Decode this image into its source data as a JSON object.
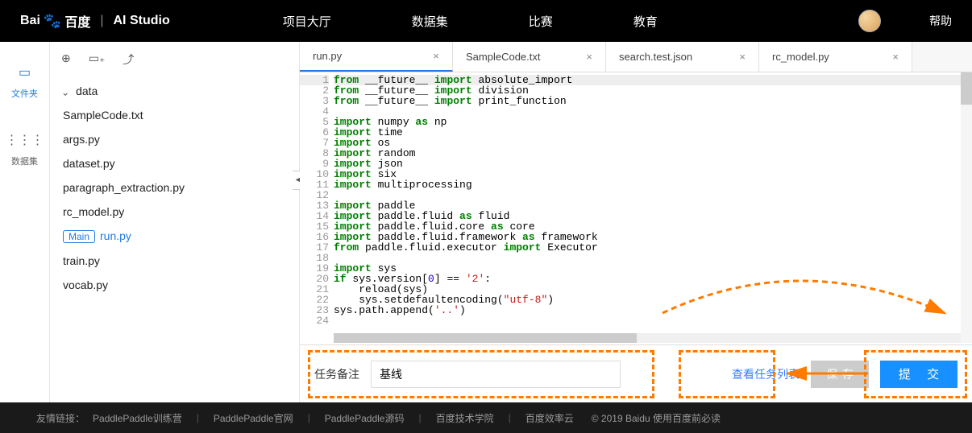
{
  "header": {
    "logo_brand": "Bai",
    "logo_brand2": "百度",
    "logo_app": "AI Studio",
    "nav": [
      "项目大厅",
      "数据集",
      "比赛",
      "教育"
    ],
    "help": "帮助"
  },
  "leftrail": {
    "files_label": "文件夹",
    "dataset_label": "数据集"
  },
  "filetree": {
    "folder": "data",
    "items": [
      "SampleCode.txt",
      "args.py",
      "dataset.py",
      "paragraph_extraction.py",
      "rc_model.py"
    ],
    "main_tag": "Main",
    "main_file": "run.py",
    "items2": [
      "train.py",
      "vocab.py"
    ]
  },
  "tabs": [
    "run.py",
    "SampleCode.txt",
    "search.test.json",
    "rc_model.py"
  ],
  "code": {
    "lines": [
      {
        "n": 1,
        "html": "<span class='kw1'>from</span> __future__ <span class='kw2'>import</span> absolute_import"
      },
      {
        "n": 2,
        "html": "<span class='kw1'>from</span> __future__ <span class='kw2'>import</span> division"
      },
      {
        "n": 3,
        "html": "<span class='kw1'>from</span> __future__ <span class='kw2'>import</span> print_function"
      },
      {
        "n": 4,
        "html": ""
      },
      {
        "n": 5,
        "html": "<span class='kw2'>import</span> numpy <span class='kw1'>as</span> np"
      },
      {
        "n": 6,
        "html": "<span class='kw2'>import</span> time"
      },
      {
        "n": 7,
        "html": "<span class='kw2'>import</span> os"
      },
      {
        "n": 8,
        "html": "<span class='kw2'>import</span> random"
      },
      {
        "n": 9,
        "html": "<span class='kw2'>import</span> json"
      },
      {
        "n": 10,
        "html": "<span class='kw2'>import</span> six"
      },
      {
        "n": 11,
        "html": "<span class='kw2'>import</span> multiprocessing"
      },
      {
        "n": 12,
        "html": ""
      },
      {
        "n": 13,
        "html": "<span class='kw2'>import</span> paddle"
      },
      {
        "n": 14,
        "html": "<span class='kw2'>import</span> paddle.fluid <span class='kw1'>as</span> fluid"
      },
      {
        "n": 15,
        "html": "<span class='kw2'>import</span> paddle.fluid.core <span class='kw1'>as</span> core"
      },
      {
        "n": 16,
        "html": "<span class='kw2'>import</span> paddle.fluid.framework <span class='kw1'>as</span> framework"
      },
      {
        "n": 17,
        "html": "<span class='kw1'>from</span> paddle.fluid.executor <span class='kw2'>import</span> Executor"
      },
      {
        "n": 18,
        "html": ""
      },
      {
        "n": 19,
        "html": "<span class='kw2'>import</span> sys"
      },
      {
        "n": 20,
        "html": "<span class='kw1'>if</span> sys.version[<span class='num'>0</span>] == <span class='str'>'2'</span>:"
      },
      {
        "n": 21,
        "html": "&nbsp;&nbsp;&nbsp;&nbsp;reload(sys)"
      },
      {
        "n": 22,
        "html": "&nbsp;&nbsp;&nbsp;&nbsp;sys.setdefaultencoding(<span class='str'>\"utf-8\"</span>)"
      },
      {
        "n": 23,
        "html": "sys.path.append(<span class='str'>'..'</span>)"
      },
      {
        "n": 24,
        "html": ""
      }
    ]
  },
  "bottom": {
    "task_label": "任务备注",
    "task_value": "基线",
    "view_tasks": "查看任务列表",
    "save": "保存",
    "submit": "提 交"
  },
  "footer": {
    "friends": "友情链接：",
    "links": [
      "PaddlePaddle训练营",
      "PaddlePaddle官网",
      "PaddlePaddle源码",
      "百度技术学院",
      "百度效率云"
    ],
    "copy": "© 2019 Baidu 使用百度前必读"
  }
}
